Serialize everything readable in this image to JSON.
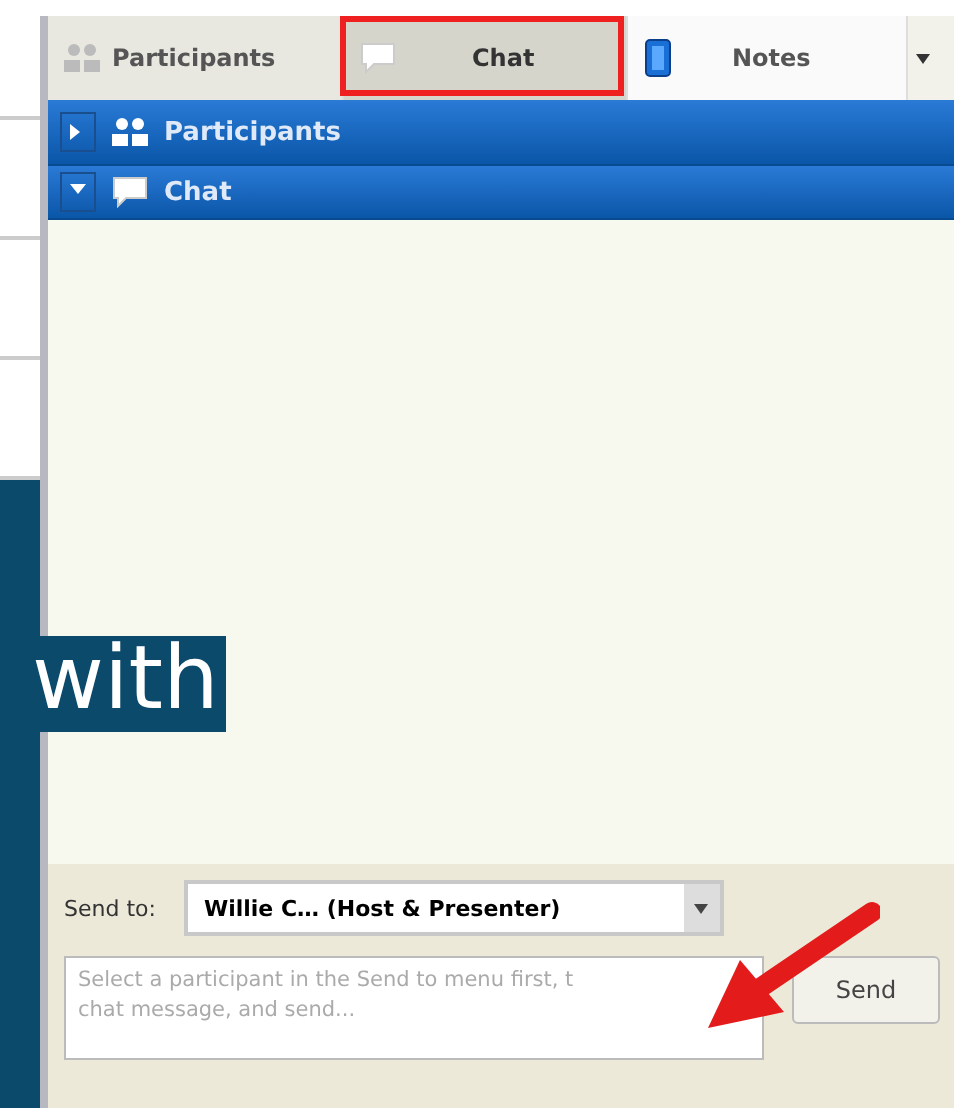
{
  "tabs": [
    {
      "label": "Participants",
      "selected": false
    },
    {
      "label": "Chat",
      "selected": true
    },
    {
      "label": "Notes",
      "selected": false
    }
  ],
  "sections": [
    {
      "title": "Participants",
      "expanded": false
    },
    {
      "title": "Chat",
      "expanded": true
    }
  ],
  "overlay_text": "with",
  "send_to": {
    "label": "Send to:",
    "value": "Willie C… (Host & Presenter)"
  },
  "message": {
    "placeholder": "Select a participant in the Send to menu first, t\nchat message, and send..."
  },
  "send_button": "Send"
}
